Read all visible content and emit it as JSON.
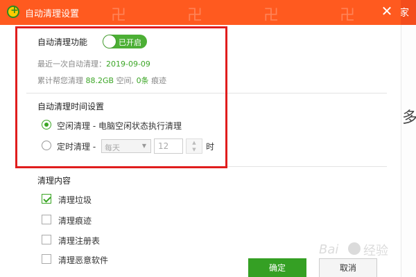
{
  "background_app": {
    "home_fragment": "家",
    "side_fragment": "多"
  },
  "dialog": {
    "title": "自动清理设置",
    "close_glyph": "✕"
  },
  "auto_clean": {
    "label": "自动清理功能",
    "toggle_state_label": "已开启",
    "last_clean_label": "最近一次自动清理：",
    "last_clean_date": "2019-09-09",
    "total_prefix": "累计帮您清理",
    "total_space": "88.2GB",
    "total_space_suffix": "空间,",
    "total_traces": "0条",
    "total_traces_suffix": "痕迹"
  },
  "schedule": {
    "heading": "自动清理时间设置",
    "options": [
      {
        "label": "空闲清理 - 电脑空闲状态执行清理",
        "selected": true
      },
      {
        "label": "定时清理 -",
        "selected": false
      }
    ],
    "frequency": "每天",
    "hour_value": "12",
    "hour_unit": "时"
  },
  "content": {
    "heading": "清理内容",
    "items": [
      {
        "label": "清理垃圾",
        "checked": true
      },
      {
        "label": "清理痕迹",
        "checked": false
      },
      {
        "label": "清理注册表",
        "checked": false
      },
      {
        "label": "清理恶意软件",
        "checked": false
      }
    ]
  },
  "buttons": {
    "ok": "确定",
    "cancel": "取消"
  },
  "watermark": {
    "brand_latin": "Bai",
    "brand_cn": "经验"
  },
  "colors": {
    "titlebar": "#ff5a1f",
    "accent_green": "#3aa524",
    "highlight_red": "#e01d1d"
  }
}
